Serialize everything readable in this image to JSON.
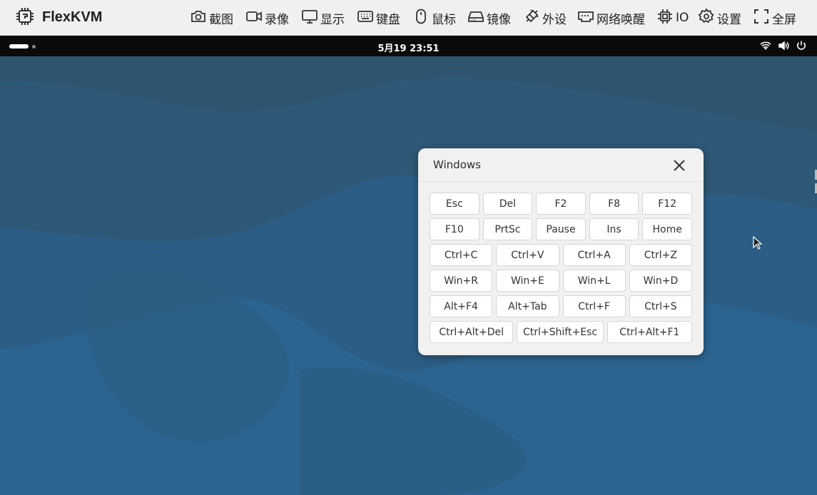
{
  "app": {
    "brand_name": "FlexKVM",
    "brand_icon": "chip-logo-icon"
  },
  "toolbar": {
    "items": [
      {
        "label": "截图",
        "icon": "camera-icon"
      },
      {
        "label": "录像",
        "icon": "video-icon"
      },
      {
        "label": "显示",
        "icon": "monitor-icon"
      },
      {
        "label": "键盘",
        "icon": "keyboard-icon"
      },
      {
        "label": "鼠标",
        "icon": "mouse-icon"
      },
      {
        "label": "镜像",
        "icon": "drive-icon"
      },
      {
        "label": "外设",
        "icon": "plug-icon"
      },
      {
        "label": "网络唤醒",
        "icon": "ethernet-icon"
      },
      {
        "label": "IO",
        "icon": "chip-icon"
      },
      {
        "label": "设置",
        "icon": "gear-icon"
      },
      {
        "label": "全屏",
        "icon": "fullscreen-icon"
      }
    ]
  },
  "remote": {
    "clock": "5月19  23:51",
    "tray_icons": [
      "wifi-icon",
      "volume-icon",
      "power-icon"
    ]
  },
  "shortcut_panel": {
    "title": "Windows",
    "rows": [
      [
        "Esc",
        "Del",
        "F2",
        "F8",
        "F12"
      ],
      [
        "F10",
        "PrtSc",
        "Pause",
        "Ins",
        "Home"
      ],
      [
        "Ctrl+C",
        "Ctrl+V",
        "Ctrl+A",
        "Ctrl+Z"
      ],
      [
        "Win+R",
        "Win+E",
        "Win+L",
        "Win+D"
      ],
      [
        "Alt+F4",
        "Alt+Tab",
        "Ctrl+F",
        "Ctrl+S"
      ],
      [
        "Ctrl+Alt+Del",
        "Ctrl+Shift+Esc",
        "Ctrl+Alt+F1"
      ]
    ]
  },
  "colors": {
    "toolbar_bg": "#f0f0f0",
    "desktop_bg": "#2a5f86",
    "top_bar_bg": "#0b0b0b"
  }
}
